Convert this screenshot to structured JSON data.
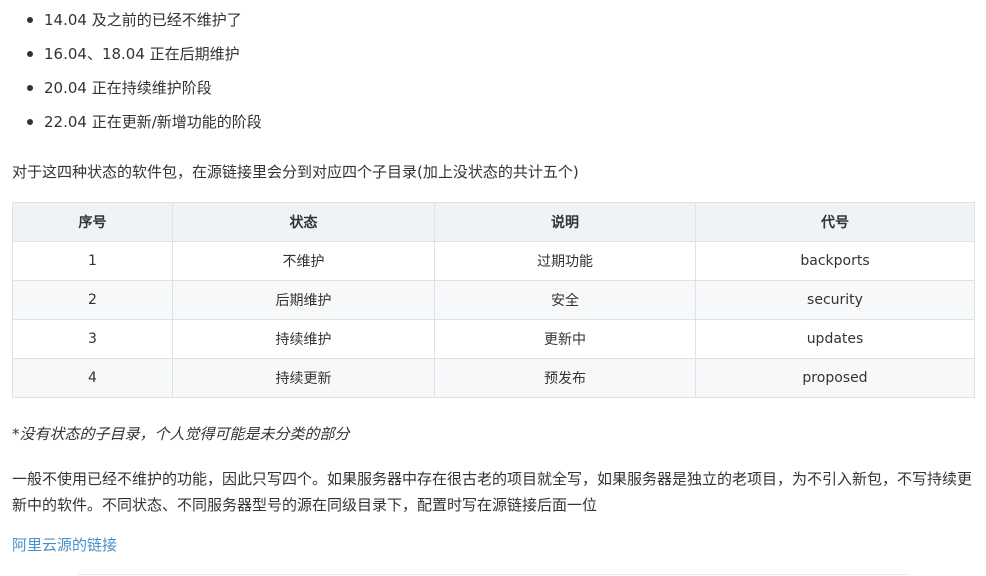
{
  "bullets": [
    "14.04 及之前的已经不维护了",
    "16.04、18.04 正在后期维护",
    "20.04 正在持续维护阶段",
    "22.04 正在更新/新增功能的阶段"
  ],
  "intro": "对于这四种状态的软件包，在源链接里会分到对应四个子目录(加上没状态的共计五个)",
  "table": {
    "headers": [
      "序号",
      "状态",
      "说明",
      "代号"
    ],
    "rows": [
      [
        "1",
        "不维护",
        "过期功能",
        "backports"
      ],
      [
        "2",
        "后期维护",
        "安全",
        "security"
      ],
      [
        "3",
        "持续维护",
        "更新中",
        "updates"
      ],
      [
        "4",
        "持续更新",
        "预发布",
        "proposed"
      ]
    ]
  },
  "note": "*没有状态的子目录，个人觉得可能是未分类的部分",
  "body": "一般不使用已经不维护的功能，因此只写四个。如果服务器中存在很古老的项目就全写，如果服务器是独立的老项目，为不引入新包，不写持续更新中的软件。不同状态、不同服务器型号的源在同级目录下，配置时写在源链接后面一位",
  "link": "阿里云源的链接",
  "colors": {
    "text": "#333333",
    "link": "#4a90c8",
    "header_bg": "#eff3f5",
    "stripe_bg": "#f6f8fa",
    "border": "#dfe2e5"
  }
}
